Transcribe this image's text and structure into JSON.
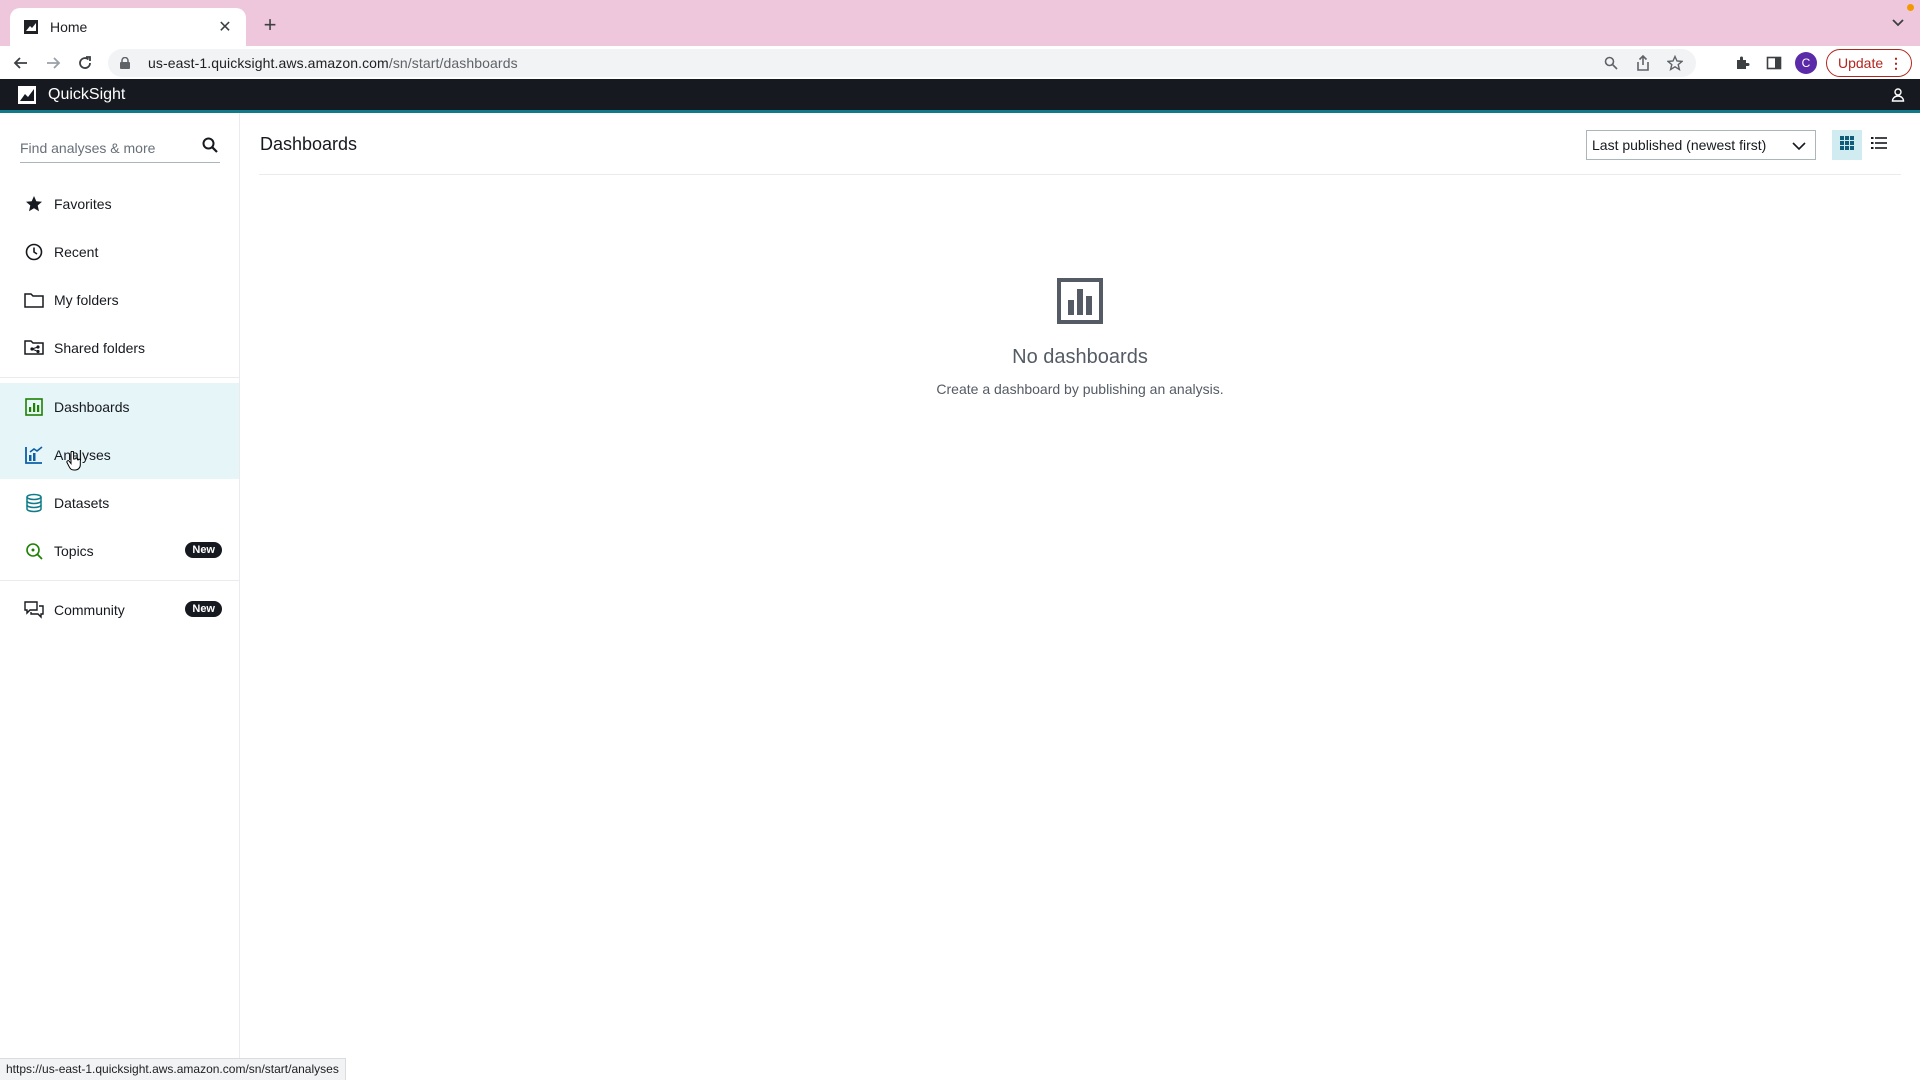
{
  "browser": {
    "tab_title": "Home",
    "url_host": "us-east-1.quicksight.aws.amazon.com",
    "url_path": "/sn/start/dashboards",
    "update_label": "Update",
    "profile_initial": "C",
    "status_url": "https://us-east-1.quicksight.aws.amazon.com/sn/start/analyses"
  },
  "app": {
    "name": "QuickSight"
  },
  "sidebar": {
    "search_placeholder": "Find analyses & more",
    "items": [
      {
        "label": "Favorites",
        "icon": "star-icon"
      },
      {
        "label": "Recent",
        "icon": "clock-icon"
      },
      {
        "label": "My folders",
        "icon": "folder-icon"
      },
      {
        "label": "Shared folders",
        "icon": "shared-folder-icon"
      },
      {
        "label": "Dashboards",
        "icon": "dashboard-icon",
        "active": true
      },
      {
        "label": "Analyses",
        "icon": "analysis-icon"
      },
      {
        "label": "Datasets",
        "icon": "dataset-icon"
      },
      {
        "label": "Topics",
        "icon": "topics-icon",
        "badge": "New"
      },
      {
        "label": "Community",
        "icon": "community-icon",
        "badge": "New"
      }
    ]
  },
  "main": {
    "title": "Dashboards",
    "sort_label": "Last published (newest first)",
    "empty_title": "No dashboards",
    "empty_subtitle": "Create a dashboard by publishing an analysis."
  },
  "colors": {
    "accent": "#0f7b8a",
    "active_bg": "#e6f5f7",
    "header_bg": "#16191f",
    "tabbar_bg": "#efc7dd",
    "update_red": "#b3261e"
  }
}
